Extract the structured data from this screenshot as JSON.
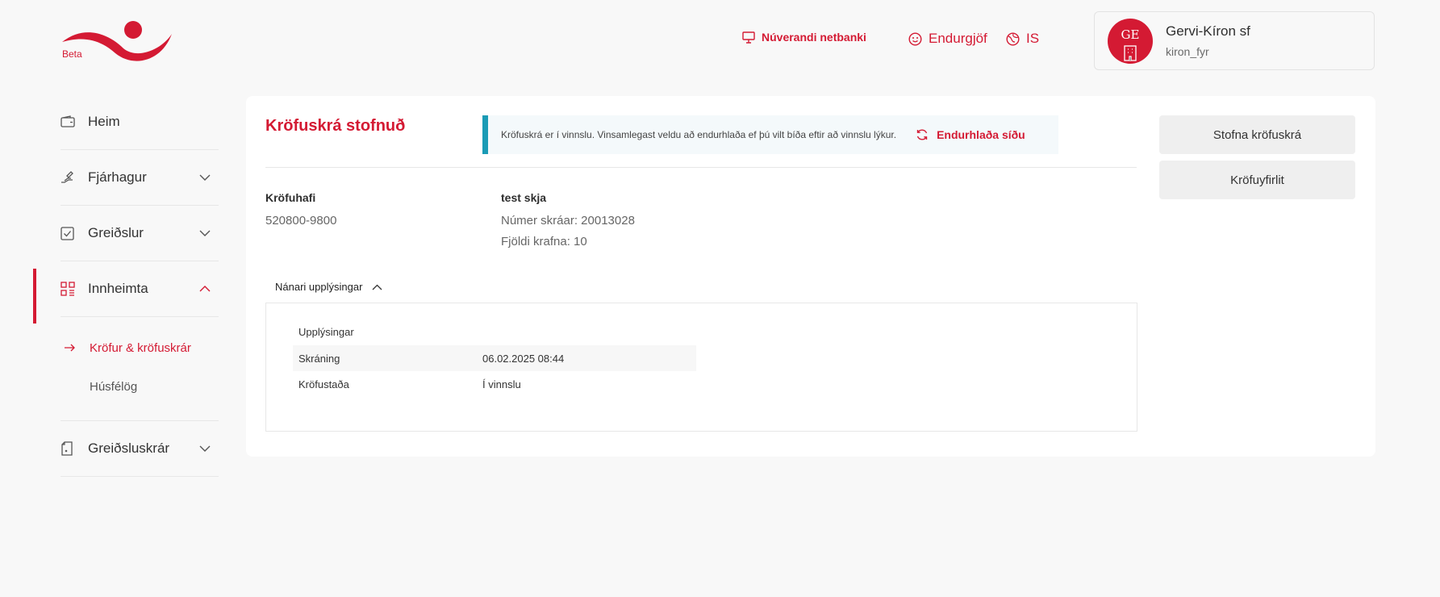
{
  "brand": {
    "badge": "Beta",
    "accent": "#d41a33",
    "info_accent": "#1a9bb5"
  },
  "header": {
    "current_bank": "Núverandi netbanki",
    "feedback": "Endurgjöf",
    "language": "IS",
    "user": {
      "initials": "GE",
      "name": "Gervi-Kíron sf",
      "username": "kiron_fyr"
    }
  },
  "sidebar": {
    "items": [
      {
        "label": "Heim",
        "icon": "wallet-icon"
      },
      {
        "label": "Fjárhagur",
        "icon": "money-hand-icon"
      },
      {
        "label": "Greiðslur",
        "icon": "checkbox-icon"
      },
      {
        "label": "Innheimta",
        "icon": "grid-icon"
      },
      {
        "label": "Greiðsluskrár",
        "icon": "document-icon"
      }
    ],
    "sub_items": [
      {
        "label": "Kröfur & kröfuskrár"
      },
      {
        "label": "Húsfélög"
      }
    ]
  },
  "main": {
    "title": "Kröfuskrá stofnuð",
    "notice": "Kröfuskrá er í vinnslu. Vinsamlegast veldu að endurhlaða ef þú vilt bíða eftir að vinnslu lýkur.",
    "reload": "Endurhlaða síðu",
    "claimant_label": "Kröfuhafi",
    "claimant_id": "520800-9800",
    "file_name": "test skja",
    "file_number": "Númer skráar: 20013028",
    "claim_count": "Fjöldi krafna: 10",
    "details_toggle": "Nánari upplýsingar",
    "details": {
      "title": "Upplýsingar",
      "rows": [
        {
          "key": "Skráning",
          "value": "06.02.2025 08:44"
        },
        {
          "key": "Kröfustaða",
          "value": "Í vinnslu"
        }
      ]
    }
  },
  "actions": {
    "create": "Stofna kröfuskrá",
    "overview": "Kröfuyfirlit"
  }
}
